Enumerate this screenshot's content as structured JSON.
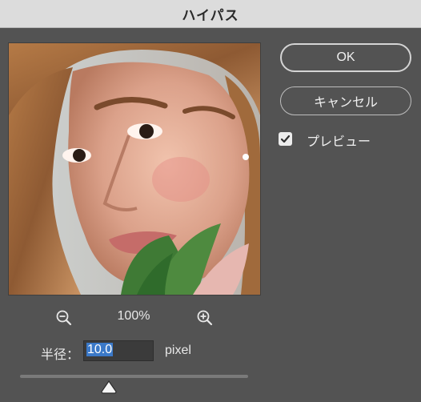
{
  "dialog": {
    "title": "ハイパス"
  },
  "buttons": {
    "ok": "OK",
    "cancel": "キャンセル"
  },
  "preview": {
    "label": "プレビュー",
    "checked": true
  },
  "zoom": {
    "level": "100%"
  },
  "radius": {
    "label": "半径：",
    "value": "10.0",
    "unit": "pixel",
    "slider_fraction": 0.39
  },
  "icons": {
    "zoom_out": "zoom-out-icon",
    "zoom_in": "zoom-in-icon",
    "check": "checkmark-icon",
    "slider_thumb": "triangle-thumb-icon"
  },
  "colors": {
    "background": "#535353",
    "titlebar": "#dcdcdc",
    "selection": "#3b79c8"
  }
}
